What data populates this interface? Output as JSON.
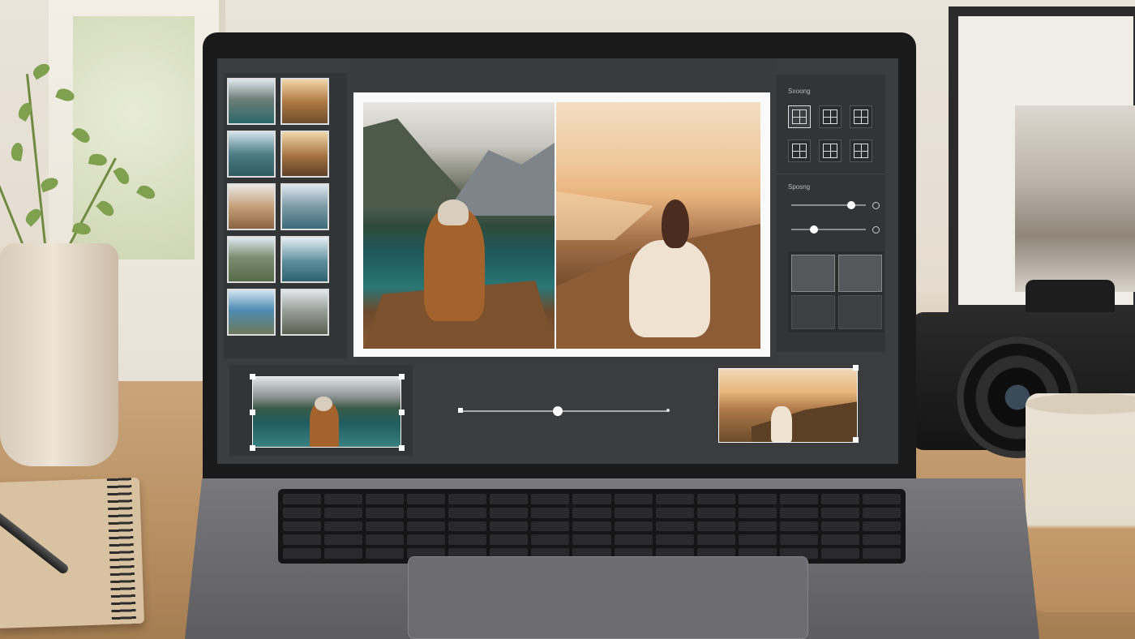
{
  "scene": {
    "colors": {
      "desk": "#b88f62",
      "screen_bg": "#3b3c3e",
      "panel_bg": "#333436",
      "accent": "#ffffff"
    }
  },
  "app": {
    "thumbnails": [
      {
        "id": "thumb-1",
        "subject": "mountain-lake"
      },
      {
        "id": "thumb-2",
        "subject": "hiker-rocks"
      },
      {
        "id": "thumb-3",
        "subject": "coastal-cliff"
      },
      {
        "id": "thumb-4",
        "subject": "sitting-hill"
      },
      {
        "id": "thumb-5",
        "subject": "beach-sunset"
      },
      {
        "id": "thumb-6",
        "subject": "lake-sitting"
      },
      {
        "id": "thumb-7",
        "subject": "mountain-walk"
      },
      {
        "id": "thumb-8",
        "subject": "lake-shore"
      },
      {
        "id": "thumb-9",
        "subject": "coast-view"
      },
      {
        "id": "thumb-10",
        "subject": "group-hikers"
      }
    ],
    "right_panel": {
      "layout_label": "Sııoong",
      "spacing_label": "Sposng",
      "layouts": [
        "grid-2x2",
        "grid-3-col",
        "grid-2-col",
        "grid-2x2-alt",
        "grid-3x2",
        "grid-3x3"
      ],
      "active_layout": 0,
      "sliders": [
        {
          "name": "spacing",
          "value": 0.8
        },
        {
          "name": "border",
          "value": 0.3
        }
      ]
    },
    "timeline": {
      "value": 0.47
    }
  }
}
